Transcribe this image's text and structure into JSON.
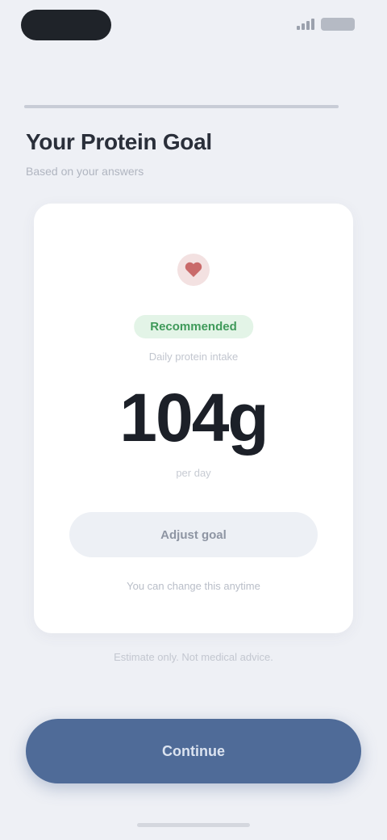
{
  "status_bar": {
    "time": "",
    "icons": [
      "signal-icon",
      "battery-icon"
    ]
  },
  "progress": {
    "step": 1.0
  },
  "header": {
    "title": "Your Protein Goal",
    "subtitle": "Based on your answers"
  },
  "result": {
    "icon": "heart-icon",
    "badge": "Recommended",
    "caption": "Daily protein intake",
    "value": "104g",
    "unit_caption": "per day",
    "secondary_button": "Adjust goal",
    "footnote": "You can change this anytime"
  },
  "disclaimer": "Estimate only. Not medical advice.",
  "primary_button": "Continue",
  "colors": {
    "background": "#eef0f5",
    "accent": "#4f6b98",
    "badge_green": "#3f9a5a",
    "heart_red": "#c96a6a"
  }
}
